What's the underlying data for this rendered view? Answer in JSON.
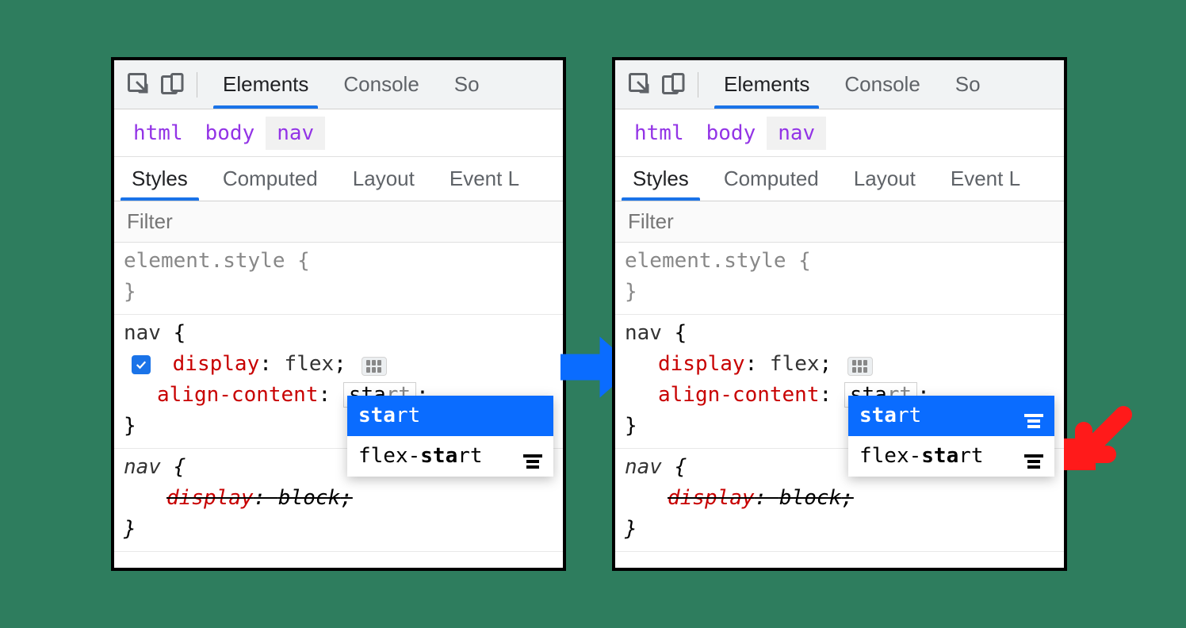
{
  "toolbar": {
    "tabs": [
      "Elements",
      "Console",
      "So"
    ]
  },
  "breadcrumb": {
    "items": [
      "html",
      "body",
      "nav"
    ]
  },
  "subtabs": {
    "items": [
      "Styles",
      "Computed",
      "Layout",
      "Event L"
    ]
  },
  "filter": {
    "placeholder": "Filter"
  },
  "styles": {
    "inline_selector": "element.style",
    "rule1": {
      "selector": "nav",
      "prop1": "display",
      "val1": "flex",
      "prop2": "align-content",
      "val2_typed": "sta",
      "val2_rest": "rt"
    },
    "rule2": {
      "selector": "nav",
      "prop": "display",
      "val": "block"
    }
  },
  "dropdown": {
    "item1_bold": "sta",
    "item1_rest": "rt",
    "item2_pre": "flex-",
    "item2_bold": "sta",
    "item2_rest": "rt"
  },
  "braces": {
    "open": "{",
    "close": "}"
  },
  "punct": {
    "colon": ":",
    "semi": ";"
  }
}
